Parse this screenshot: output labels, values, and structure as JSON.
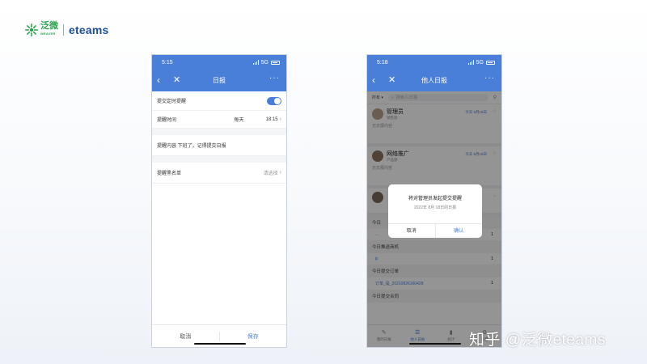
{
  "brand": {
    "cn": "泛微",
    "cn_sub": "WEAVER",
    "en": "eteams",
    "color_green": "#2ba34a",
    "color_blue": "#1c4f9c"
  },
  "left_phone": {
    "time": "5:15",
    "network": "5G",
    "title": "日报",
    "icons": {
      "back": "‹",
      "close": "✕",
      "more": "···"
    },
    "rows": {
      "submit_reminder": "提交定时提醒",
      "remind_time_label": "提醒时间",
      "remind_time_freq": "每天",
      "remind_time_value": "18:15",
      "remind_content": "提醒内容 下班了，记得提交日报",
      "whitelist_label": "提醒黑名单",
      "whitelist_value": "请选择"
    },
    "footer": {
      "cancel": "取消",
      "save": "保存"
    }
  },
  "right_phone": {
    "time": "5:18",
    "network": "5G",
    "title": "他人日报",
    "filter_label": "所有",
    "search_placeholder": "搜索人/日报",
    "cards": [
      {
        "name": "管理员",
        "dept": "销售部",
        "date": "今天 8月18日",
        "status": "无日报内容"
      },
      {
        "name": "网络推广",
        "dept": "产品部",
        "date": "今天 8月18日",
        "status": "无日报内容"
      }
    ],
    "sections": [
      {
        "title": "今日",
        "item": "…",
        "count": "1"
      },
      {
        "title": "今日推送商机",
        "item": "jc",
        "count": "1"
      },
      {
        "title": "今日提交订单",
        "item": "订单_是_20210826160428",
        "count": "1"
      },
      {
        "title": "今日提交合同",
        "item": "",
        "count": ""
      }
    ],
    "dialog": {
      "title": "将对管理员发起提交提醒",
      "subtitle": "2022年 8月 18日的日报",
      "cancel": "取消",
      "confirm": "确认"
    },
    "tabs": [
      {
        "icon": "✎",
        "label": "我的日报"
      },
      {
        "icon": "☰",
        "label": "他人日报"
      },
      {
        "icon": "▮",
        "label": "统计"
      },
      {
        "icon": "⚙",
        "label": "设置"
      }
    ]
  },
  "watermark": "知乎 @泛微eteams",
  "colors": {
    "accent": "#4a7fd9"
  }
}
